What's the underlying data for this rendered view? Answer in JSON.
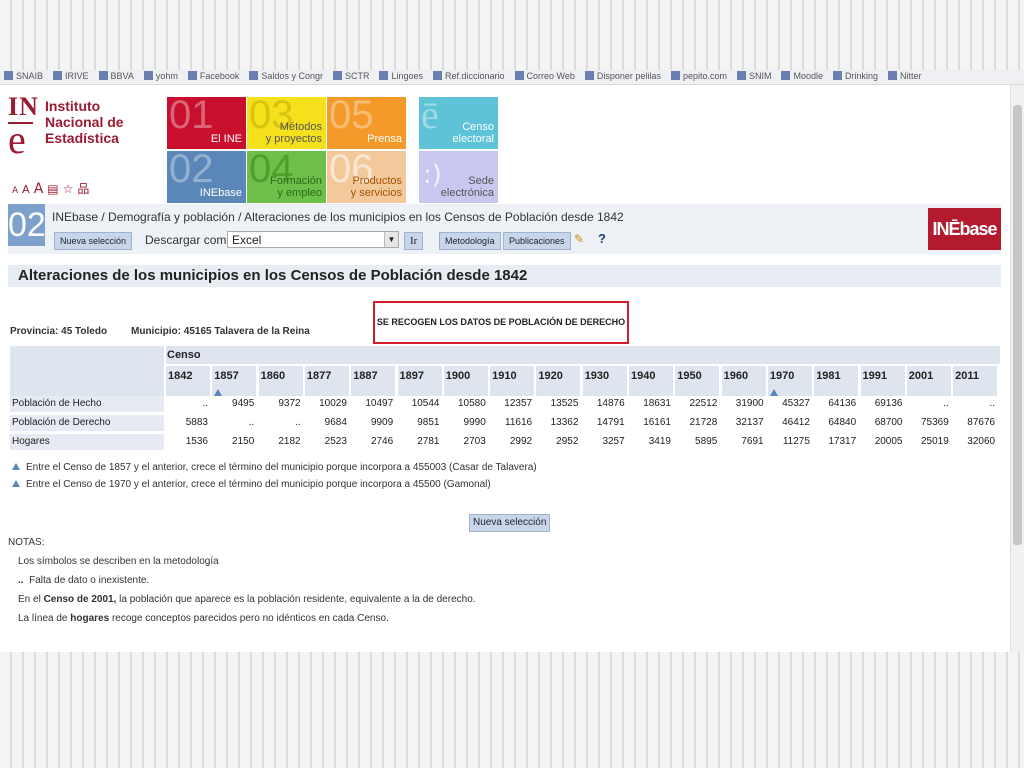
{
  "bookmarks": [
    "SNAIB",
    "IRIVE",
    "BBVA",
    "yohm",
    "Facebook",
    "Saldos y Congr",
    "SCTR",
    "Lingoes",
    "Ref.diccionario",
    "Correo Web",
    "Disponer pelilas",
    "pepito.com",
    "SNIM",
    "Moodle",
    "Drinking",
    "Nitter"
  ],
  "logo": {
    "mark_in": "IN",
    "mark_e": "e",
    "line1": "Instituto",
    "line2": "Nacional de",
    "line3": "Estadística",
    "tool_a_small": "A",
    "tool_a_medium": "A",
    "tool_a_large": "A",
    "tool_print": "▤",
    "tool_star": "☆",
    "tool_sitemap": "品"
  },
  "tiles": {
    "t01": {
      "num": "01",
      "label": "El INE"
    },
    "t02": {
      "num": "02",
      "label": "INEbase"
    },
    "t03": {
      "num": "03",
      "label1": "Métodos",
      "label2": "y proyectos"
    },
    "t04": {
      "num": "04",
      "label1": "Formación",
      "label2": "y empleo"
    },
    "t05": {
      "num": "05",
      "label": "Prensa"
    },
    "t06": {
      "num": "06",
      "label1": "Productos",
      "label2": "y servicios"
    },
    "censo": {
      "mark": "ē",
      "label1": "Censo",
      "label2": "electoral"
    },
    "sede": {
      "mark": ":)",
      "label1": "Sede",
      "label2": "electrónica"
    }
  },
  "nav": {
    "num": "02",
    "breadcrumb": "INEbase / Demografía y población / Alteraciones de los municipios en los Censos de Población desde 1842",
    "nueva_seleccion": "Nueva selección",
    "descargar_como": "Descargar como",
    "format": "Excel",
    "ir": "Ir",
    "metodologia": "Metodología",
    "publicaciones": "Publicaciones",
    "help": "?",
    "inebase_logo": "INĒbase"
  },
  "page_title": "Alteraciones de los municipios en los Censos de Población desde 1842",
  "provincia": "Provincia: 45 Toledo",
  "municipio": "Municipio: 45165 Talavera de la Reina",
  "notice": "SE RECOGEN LOS DATOS DE POBLACIÓN DE DERECHO",
  "table": {
    "header": "Censo",
    "years": [
      {
        "label": "1842",
        "mark": false
      },
      {
        "label": "1857",
        "mark": true
      },
      {
        "label": "1860",
        "mark": false
      },
      {
        "label": "1877",
        "mark": false
      },
      {
        "label": "1887",
        "mark": false
      },
      {
        "label": "1897",
        "mark": false
      },
      {
        "label": "1900",
        "mark": false
      },
      {
        "label": "1910",
        "mark": false
      },
      {
        "label": "1920",
        "mark": false
      },
      {
        "label": "1930",
        "mark": false
      },
      {
        "label": "1940",
        "mark": false
      },
      {
        "label": "1950",
        "mark": false
      },
      {
        "label": "1960",
        "mark": false
      },
      {
        "label": "1970",
        "mark": true
      },
      {
        "label": "1981",
        "mark": false
      },
      {
        "label": "1991",
        "mark": false
      },
      {
        "label": "2001",
        "mark": false
      },
      {
        "label": "2011",
        "mark": false
      }
    ],
    "rows": [
      {
        "label": "Población de Hecho",
        "values": [
          "..",
          "9495",
          "9372",
          "10029",
          "10497",
          "10544",
          "10580",
          "12357",
          "13525",
          "14876",
          "18631",
          "22512",
          "31900",
          "45327",
          "64136",
          "69136",
          "..",
          ".."
        ]
      },
      {
        "label": "Población de Derecho",
        "values": [
          "5883",
          "..",
          "..",
          "9684",
          "9909",
          "9851",
          "9990",
          "11616",
          "13362",
          "14791",
          "16161",
          "21728",
          "32137",
          "46412",
          "64840",
          "68700",
          "75369",
          "87676"
        ]
      },
      {
        "label": "Hogares",
        "values": [
          "1536",
          "2150",
          "2182",
          "2523",
          "2746",
          "2781",
          "2703",
          "2992",
          "2952",
          "3257",
          "3419",
          "5895",
          "7691",
          "11275",
          "17317",
          "20005",
          "25019",
          "32060"
        ]
      }
    ]
  },
  "footnotes": [
    "Entre el Censo de 1857 y el anterior, crece el término del municipio porque incorpora a 455003 (Casar de Talavera)",
    "Entre el Censo de 1970 y el anterior, crece el término del municipio porque incorpora a 45500 (Gamonal)"
  ],
  "nueva_seleccion_bottom": "Nueva selección",
  "notas_title": "NOTAS:",
  "notes": {
    "n1": "Los símbolos se describen en la metodología",
    "n2_sym": "..",
    "n2_text": "Falta de dato o inexistente.",
    "n3_a": "En el ",
    "n3_b": "Censo de 2001,",
    "n3_c": " la población que aparece es la población residente, equivalente a la de derecho.",
    "n4_a": "La línea de ",
    "n4_b": "hogares",
    "n4_c": " recoge conceptos parecidos pero no idénticos en cada Censo."
  }
}
